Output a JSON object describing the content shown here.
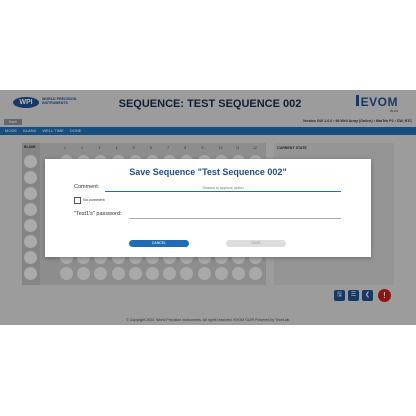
{
  "header": {
    "logo_badge": "WPI",
    "logo_text": "WORLD PRECISION INSTRUMENTS",
    "title": "SEQUENCE: TEST SEQUENCE 002",
    "product": "EVOM",
    "product_sub": "Auto",
    "back_label": "Back",
    "device_info": "Version GUI 1.0.0 • 96 Well Array (Online) • MarTek P2 • CW, NTC"
  },
  "subnav": {
    "items": [
      "MODE",
      "BLANK",
      "WELL TIME",
      "DONE"
    ]
  },
  "plate": {
    "blank_label": "BLANK",
    "columns": [
      "1",
      "2",
      "3",
      "4",
      "5",
      "6",
      "7",
      "8",
      "9",
      "10",
      "11",
      "12"
    ]
  },
  "state_panel": {
    "label": "CURRENT STATE"
  },
  "toolbar": {
    "save_icon": "save-icon",
    "list_icon": "list-icon",
    "back_icon": "arrow-left-icon",
    "alert_icon": "alert-icon",
    "alert_glyph": "!"
  },
  "footer": {
    "text": "© Copyright 2024. World Precision Instruments. All rights reserved. EVOM GUI® Powered by TriceLab."
  },
  "dialog": {
    "title": "Save Sequence \"Test Sequence 002\"",
    "comment_label": "Comment:",
    "comment_placeholder": "Reason to approve action",
    "no_comment_label": "No comment",
    "password_label": "\"Test1's\" password:",
    "cancel_label": "CANCEL",
    "save_label": "SAVE"
  },
  "colors": {
    "accent": "#1f6cb5",
    "brand": "#1f4e8c",
    "alert": "#c81b1b"
  }
}
